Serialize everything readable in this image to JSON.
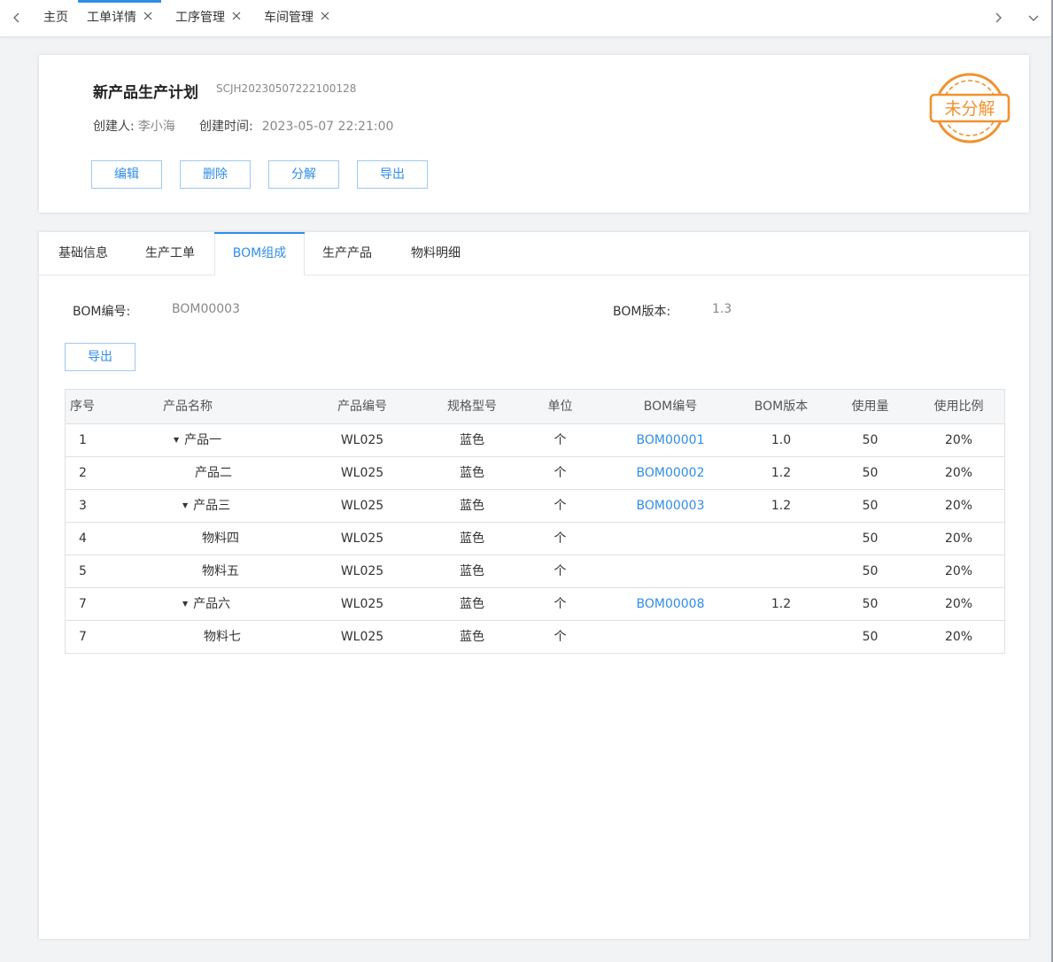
{
  "colors": {
    "accent": "#2f8ee8",
    "stamp": "#f0922e"
  },
  "topbar": {
    "tabs": [
      {
        "label": "主页"
      },
      {
        "label": "工单详情"
      },
      {
        "label": "工序管理"
      },
      {
        "label": "车间管理"
      }
    ]
  },
  "header": {
    "title": "新产品生产计划",
    "code": "SCJH20230507222100128",
    "creator_label": "创建人:",
    "creator": "李小海",
    "created_label": "创建时间:",
    "created_time": "2023-05-07 22:21:00",
    "buttons": {
      "edit": "编辑",
      "delete": "删除",
      "decompose": "分解",
      "export": "导出"
    },
    "stamp_text": "未分解"
  },
  "main": {
    "tabs": [
      {
        "label": "基础信息"
      },
      {
        "label": "生产工单"
      },
      {
        "label": "BOM组成"
      },
      {
        "label": "生产产品"
      },
      {
        "label": "物料明细"
      }
    ],
    "bom_no_label": "BOM编号:",
    "bom_no": "BOM00003",
    "bom_ver_label": "BOM版本:",
    "bom_ver": "1.3",
    "export_label": "导出",
    "columns": [
      "序号",
      "产品名称",
      "产品编号",
      "规格型号",
      "单位",
      "BOM编号",
      "BOM版本",
      "使用量",
      "使用比例"
    ],
    "rows": [
      {
        "idx": "1",
        "name": "产品一",
        "code": "WL025",
        "spec": "蓝色",
        "unit": "个",
        "bom": "BOM00001",
        "ver": "1.0",
        "qty": "50",
        "ratio": "20%"
      },
      {
        "idx": "2",
        "name": "产品二",
        "code": "WL025",
        "spec": "蓝色",
        "unit": "个",
        "bom": "BOM00002",
        "ver": "1.2",
        "qty": "50",
        "ratio": "20%"
      },
      {
        "idx": "3",
        "name": "产品三",
        "code": "WL025",
        "spec": "蓝色",
        "unit": "个",
        "bom": "BOM00003",
        "ver": "1.2",
        "qty": "50",
        "ratio": "20%"
      },
      {
        "idx": "4",
        "name": "物料四",
        "code": "WL025",
        "spec": "蓝色",
        "unit": "个",
        "bom": "",
        "ver": "",
        "qty": "50",
        "ratio": "20%"
      },
      {
        "idx": "5",
        "name": "物料五",
        "code": "WL025",
        "spec": "蓝色",
        "unit": "个",
        "bom": "",
        "ver": "",
        "qty": "50",
        "ratio": "20%"
      },
      {
        "idx": "7",
        "name": "产品六",
        "code": "WL025",
        "spec": "蓝色",
        "unit": "个",
        "bom": "BOM00008",
        "ver": "1.2",
        "qty": "50",
        "ratio": "20%"
      },
      {
        "idx": "7",
        "name": "物料七",
        "code": "WL025",
        "spec": "蓝色",
        "unit": "个",
        "bom": "",
        "ver": "",
        "qty": "50",
        "ratio": "20%"
      }
    ]
  }
}
